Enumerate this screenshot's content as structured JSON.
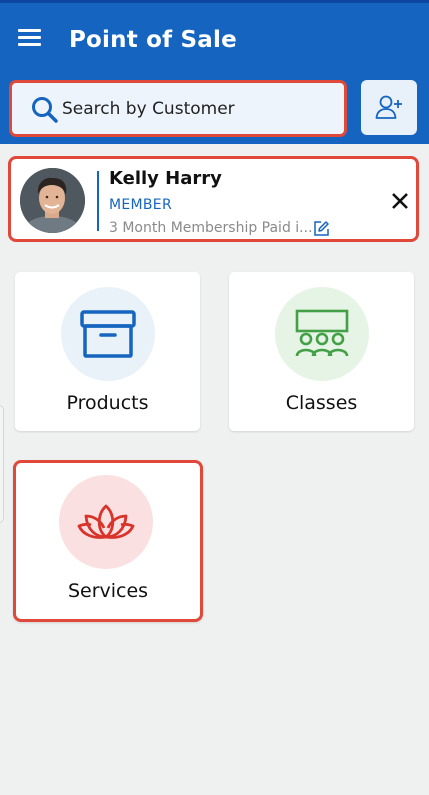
{
  "header": {
    "title": "Point of Sale",
    "menu_icon": "hamburger-menu-icon",
    "background": "#1565c0"
  },
  "search": {
    "placeholder": "Search by Customer",
    "icon": "search-icon",
    "add_customer_icon": "add-user-icon"
  },
  "customer": {
    "name": "Kelly Harry",
    "role": "MEMBER",
    "membership": "3 Month Membership Paid i...",
    "avatar": "customer-photo",
    "edit_icon": "edit-icon",
    "close_icon": "close-icon"
  },
  "tiles": [
    {
      "label": "Products",
      "icon": "archive-box-icon",
      "icon_color": "#1565c0",
      "circle_color": "#e9f1f9"
    },
    {
      "label": "Classes",
      "icon": "class-group-icon",
      "icon_color": "#43a047",
      "circle_color": "#e6f4e6"
    },
    {
      "label": "Services",
      "icon": "lotus-icon",
      "icon_color": "#d9342b",
      "circle_color": "#fbe0e1"
    }
  ],
  "colors": {
    "primary": "#1565c0",
    "highlight": "#e0483a",
    "background": "#eff0f0"
  }
}
